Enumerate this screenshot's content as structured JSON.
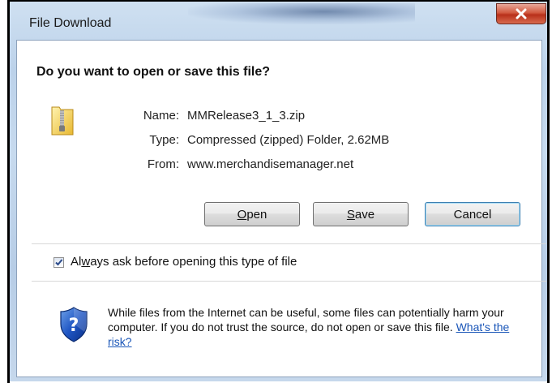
{
  "window": {
    "title": "File Download",
    "close_icon": "close-x-icon"
  },
  "dialog": {
    "question": "Do you want to open or save this file?",
    "file_icon": "zip-folder-icon",
    "info": [
      {
        "label": "Name:",
        "value": "MMRelease3_1_3.zip"
      },
      {
        "label": "Type:",
        "value": "Compressed (zipped) Folder, 2.62MB"
      },
      {
        "label": "From:",
        "value": "www.merchandisemanager.net"
      }
    ],
    "buttons": {
      "open_accel": "O",
      "open_rest": "pen",
      "save_accel": "S",
      "save_rest": "ave",
      "cancel": "Cancel"
    },
    "always_ask": {
      "checked": true,
      "prefix": "Al",
      "accel": "w",
      "suffix": "ays ask before opening this type of file"
    },
    "warning": {
      "icon": "security-shield-question-icon",
      "text": "While files from the Internet can be useful, some files can potentially harm your computer. If you do not trust the source, do not open or save this file.",
      "link": "What's the risk?"
    }
  }
}
